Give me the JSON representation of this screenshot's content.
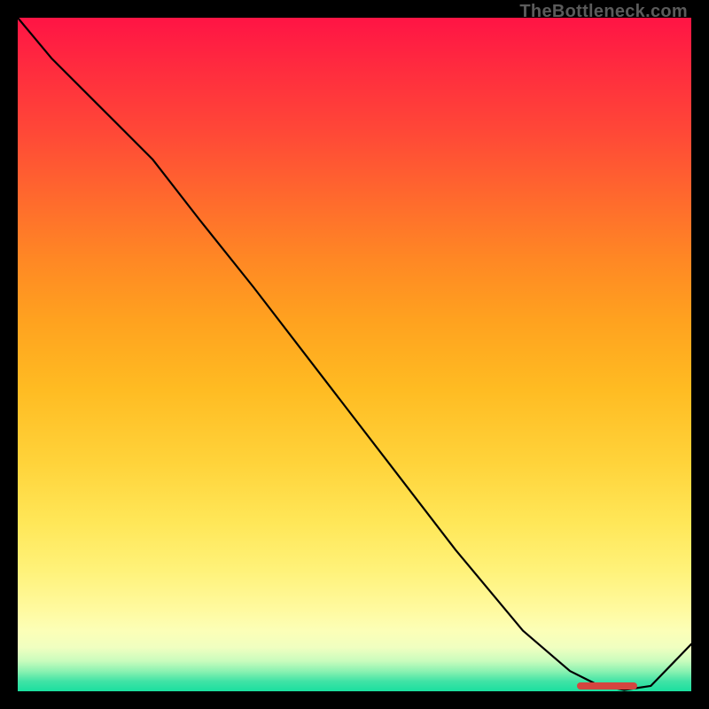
{
  "watermark": "TheBottleneck.com",
  "chart_data": {
    "type": "line",
    "title": "",
    "xlabel": "",
    "ylabel": "",
    "xlim": [
      0,
      100
    ],
    "ylim": [
      0,
      100
    ],
    "grid": false,
    "x": [
      0,
      5,
      12,
      20,
      27,
      35,
      45,
      55,
      65,
      75,
      82,
      86,
      90,
      94,
      100
    ],
    "values": [
      100,
      94,
      87,
      79,
      70,
      60,
      47,
      34,
      21,
      9,
      3,
      1,
      0.2,
      0.8,
      7
    ],
    "markers": [
      {
        "x_start": 83,
        "x_end": 92,
        "y": 0.8
      }
    ],
    "background_gradient": "red-yellow-green vertical heat gradient"
  }
}
